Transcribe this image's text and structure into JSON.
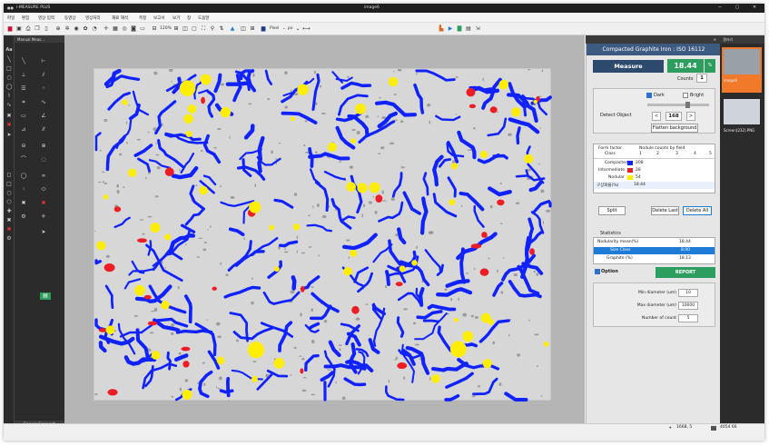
{
  "window": {
    "app_title": "i-MEASURE PLUS",
    "doc_title": "image6",
    "minimize": "─",
    "maximize": "▢",
    "close": "✕"
  },
  "menu": [
    "파일",
    "편집",
    "영상 입력",
    "동영상",
    "영상처리",
    "재료 해석",
    "측정",
    "보고서",
    "보기",
    "창",
    "도움말"
  ],
  "toolbar": {
    "zoom": "120%",
    "unit": "Pixel",
    "unit_suffix": "px"
  },
  "left_panel": {
    "title": "Manual Meas...",
    "server_connect": "Server Connect"
  },
  "right_panel": {
    "header_title": "Compacted Graphite Iron : ISO 16112",
    "measure_label": "Measure",
    "measure_value": "18.44",
    "measure_unit": "%",
    "counts_label": "Counts",
    "counts_value": "1",
    "detect_object_label": "Detect Object",
    "dark_label": "Dark",
    "dark_checked": true,
    "bright_label": "Bright",
    "bright_checked": false,
    "threshold_fraction": 0.66,
    "threshold_value": "168",
    "prev": "<",
    "next": ">",
    "flatten_background": "Flatten background",
    "table": {
      "header_col1_line1": "Form factor",
      "header_col1_line2": "Class",
      "header_group": "Nodule counts by field",
      "field_numbers": [
        "1",
        "2",
        "3",
        "4",
        "5"
      ],
      "rows": [
        {
          "label": "Compacted",
          "color": "#1022ff",
          "value": "208"
        },
        {
          "label": "Intermediate",
          "color": "#ee1c24",
          "value": "28"
        },
        {
          "label": "Nodular",
          "color": "#ffee00",
          "value": "54"
        },
        {
          "label": "구상화율(%)",
          "value": "18.44"
        }
      ]
    },
    "split_label": "Split",
    "delete_last_label": "Delete Last",
    "delete_all_label": "Delete All",
    "statistics_label": "Statistics",
    "statistics": [
      {
        "label": "Nodularity mean(%)",
        "value": "18.44"
      },
      {
        "label": "Size Class",
        "value": "8.00"
      },
      {
        "label": "Graphite (%)",
        "value": "18.13"
      }
    ],
    "option_label": "Option",
    "report_label": "REPORT",
    "options": [
      {
        "label": "Min diameter (um)",
        "value": "10"
      },
      {
        "label": "Max diameter (um)",
        "value": "10000"
      },
      {
        "label": "Number of count",
        "value": "5"
      }
    ]
  },
  "thumbs": {
    "title": "갤러리",
    "items": [
      {
        "caption": "image6"
      },
      {
        "caption": "Screen(232).PNG"
      }
    ]
  },
  "status": {
    "coords": "1668, 5",
    "size": "4054 66"
  },
  "colors": {
    "compacted": "#1022ff",
    "intermediate": "#ee1c24",
    "nodular": "#ffee00",
    "accent_green": "#2e9e5e",
    "header_blue": "#3d5a80"
  }
}
